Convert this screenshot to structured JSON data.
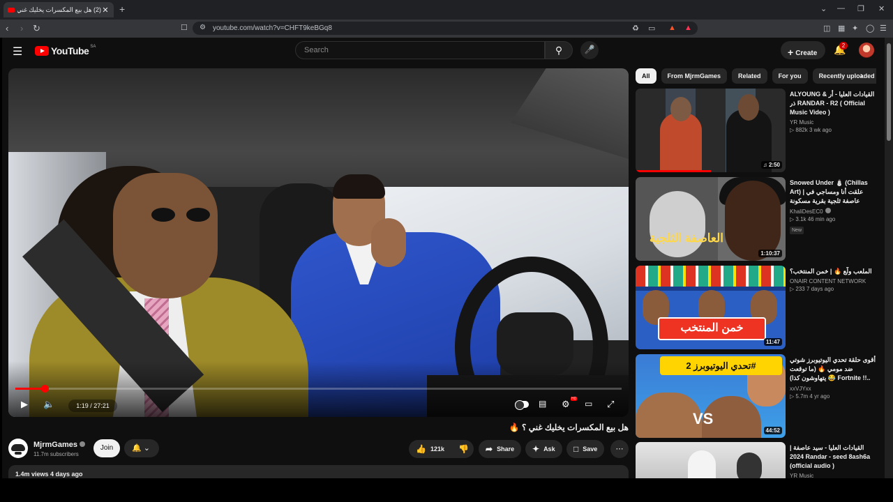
{
  "browser": {
    "tab_title": "(2) هل بيع المكسرات يخليك غني ؟ 🔥 - YouTube",
    "tab_close": "✕",
    "new_tab": "+",
    "url": "youtube.com/watch?v=CHFT9keBGq8",
    "window_controls": [
      "⌄",
      "—",
      "❐",
      "✕"
    ]
  },
  "masthead": {
    "logo_text": "YouTube",
    "country": "SA",
    "search_placeholder": "Search",
    "create_label": "Create",
    "notifications_count": "2"
  },
  "player": {
    "current_time": "1:19",
    "duration": "27:21",
    "time_display": "1:19 / 27:21",
    "progress": 0.048,
    "hd_badge": "HD"
  },
  "video": {
    "title": "هل بيع المكسرات يخليك غني ؟ 🔥",
    "channel_name": "MjrmGames",
    "subscribers": "11.7m subscribers",
    "join_label": "Join",
    "likes": "121k",
    "share_label": "Share",
    "ask_label": "Ask",
    "save_label": "Save",
    "views_date": "1.4m views  4 days ago"
  },
  "chips": [
    "All",
    "From MjrmGames",
    "Related",
    "For you",
    "Recently uploaded"
  ],
  "recommendations": [
    {
      "title": "ALYOUNG & القيادات العليا - أر ذر RANDAR - R2 ( Official Music Video )",
      "channel": "YR Music",
      "meta": "882k  3 wk ago",
      "duration": "2:50",
      "badge": "",
      "watched": 0.5
    },
    {
      "title": "Snowed Under ⛄ (Chillas Art) | علقت أنا ومساجي في عاصفة ثلجية بقرية مسكونة",
      "channel": "KhaliDesEC0",
      "meta": "3.1k  46 min ago",
      "duration": "1:10:37",
      "badge": "New",
      "watched": 0,
      "thumb_text": "العاصفة الثلجية"
    },
    {
      "title": "الملعب ولّع 🔥 | خمن المنتخب؟",
      "channel": "ONAIR CONTENT NETWORK",
      "meta": "233  7 days ago",
      "duration": "11:47",
      "badge": "",
      "watched": 0,
      "thumb_text": "خمن المنتخب"
    },
    {
      "title": "أقوى حلقة تحدي اليوتيوبرز شوتي ضد مومي 🔥 (ما توقعت يتهاوشون كذا) 😂 Fortnite !!..💔",
      "channel": "xxVJYxx",
      "meta": "5.7m  4 yr ago",
      "duration": "44:52",
      "badge": "",
      "watched": 0,
      "thumb_text": "تحدي اليوتيوبرز 2#"
    },
    {
      "title": "القيادات العليا - سيد عاصفة | 2024 Randar - seed 8ash6a (official audio )",
      "channel": "YR Music",
      "meta": "",
      "duration": "",
      "badge": "",
      "watched": 0
    }
  ],
  "colors": {
    "accent": "#ff0000",
    "background": "#0f0f0f",
    "surface": "#272727"
  }
}
